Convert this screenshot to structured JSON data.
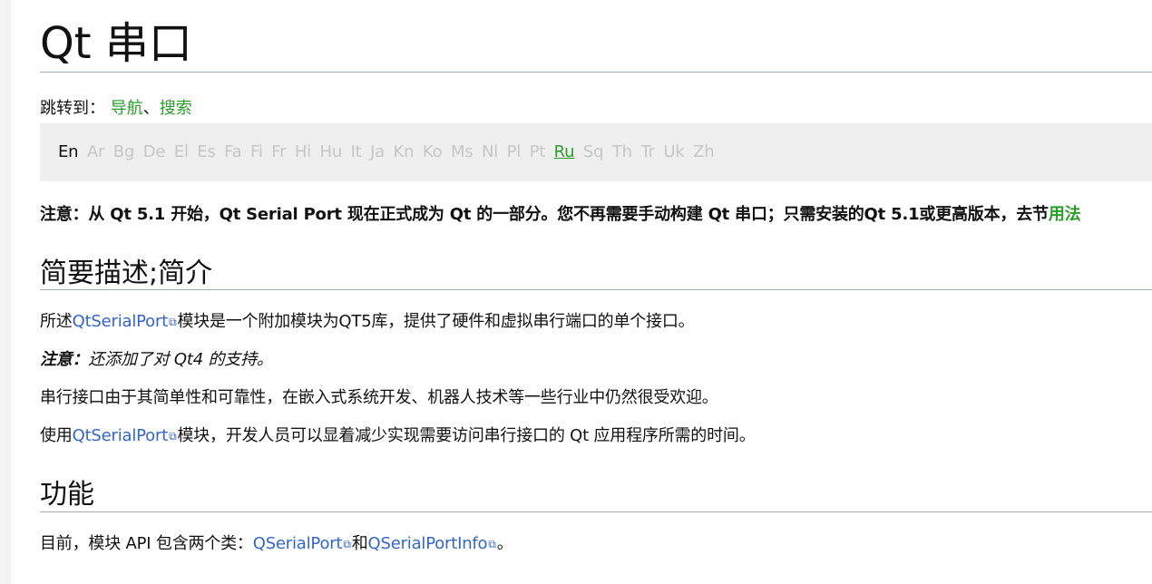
{
  "page": {
    "title": "Qt 串口",
    "jump_label": "跳转到：",
    "jump_nav": "导航",
    "jump_sep": "、",
    "jump_search": "搜索"
  },
  "languages": {
    "current": "En",
    "items_before": [
      "Ar",
      "Bg",
      "De",
      "El",
      "Es",
      "Fa",
      "Fi",
      "Fr",
      "Hi",
      "Hu",
      "It",
      "Ja",
      "Kn",
      "Ko",
      "Ms",
      "Nl",
      "Pl",
      "Pt"
    ],
    "link": "Ru",
    "items_after": [
      "Sq",
      "Th",
      "Tr",
      "Uk",
      "Zh"
    ]
  },
  "notice": {
    "text": "注意：从 Qt 5.1 开始，Qt Serial Port 现在正式成为 Qt 的一部分。您不再需要手动构建 Qt 串口；只需安装的Qt 5.1或更高版本，去节",
    "link": "用法"
  },
  "section1": {
    "heading": "简要描述;简介",
    "p1_before": "所述",
    "p1_link": "QtSerialPort",
    "p1_after": "模块是一个附加模块为QT5库，提供了硬件和虚拟串行端口的单个接口。",
    "p2_bold": "注意：",
    "p2_italic": "还添加了对 Qt4 的支持。",
    "p3": "串行接口由于其简单性和可靠性，在嵌入式系统开发、机器人技术等一些行业中仍然很受欢迎。",
    "p4_before": "使用",
    "p4_link": "QtSerialPort",
    "p4_after": "模块，开发人员可以显着减少实现需要访问串行接口的 Qt 应用程序所需的时间。"
  },
  "section2": {
    "heading": "功能",
    "p1_before": "目前，模块 API 包含两个类：",
    "p1_link1": "QSerialPort",
    "p1_mid": "和",
    "p1_link2": "QSerialPortInfo",
    "p1_after": "。"
  },
  "colors": {
    "internal_link": "#2a9d2a",
    "external_link": "#3366cc",
    "lang_inactive": "#c6c6c6"
  },
  "icons": {
    "external_link": "external-link-icon"
  }
}
